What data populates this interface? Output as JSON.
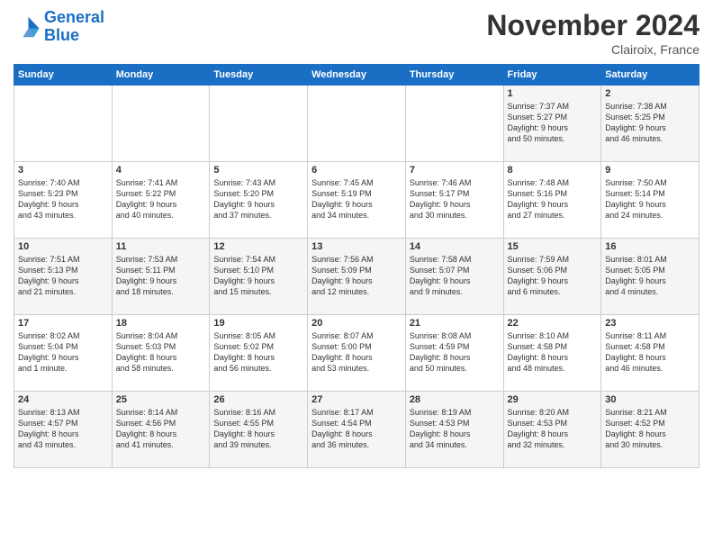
{
  "header": {
    "logo_line1": "General",
    "logo_line2": "Blue",
    "title": "November 2024",
    "location": "Clairoix, France"
  },
  "weekdays": [
    "Sunday",
    "Monday",
    "Tuesday",
    "Wednesday",
    "Thursday",
    "Friday",
    "Saturday"
  ],
  "weeks": [
    [
      {
        "day": "",
        "content": ""
      },
      {
        "day": "",
        "content": ""
      },
      {
        "day": "",
        "content": ""
      },
      {
        "day": "",
        "content": ""
      },
      {
        "day": "",
        "content": ""
      },
      {
        "day": "1",
        "content": "Sunrise: 7:37 AM\nSunset: 5:27 PM\nDaylight: 9 hours\nand 50 minutes."
      },
      {
        "day": "2",
        "content": "Sunrise: 7:38 AM\nSunset: 5:25 PM\nDaylight: 9 hours\nand 46 minutes."
      }
    ],
    [
      {
        "day": "3",
        "content": "Sunrise: 7:40 AM\nSunset: 5:23 PM\nDaylight: 9 hours\nand 43 minutes."
      },
      {
        "day": "4",
        "content": "Sunrise: 7:41 AM\nSunset: 5:22 PM\nDaylight: 9 hours\nand 40 minutes."
      },
      {
        "day": "5",
        "content": "Sunrise: 7:43 AM\nSunset: 5:20 PM\nDaylight: 9 hours\nand 37 minutes."
      },
      {
        "day": "6",
        "content": "Sunrise: 7:45 AM\nSunset: 5:19 PM\nDaylight: 9 hours\nand 34 minutes."
      },
      {
        "day": "7",
        "content": "Sunrise: 7:46 AM\nSunset: 5:17 PM\nDaylight: 9 hours\nand 30 minutes."
      },
      {
        "day": "8",
        "content": "Sunrise: 7:48 AM\nSunset: 5:16 PM\nDaylight: 9 hours\nand 27 minutes."
      },
      {
        "day": "9",
        "content": "Sunrise: 7:50 AM\nSunset: 5:14 PM\nDaylight: 9 hours\nand 24 minutes."
      }
    ],
    [
      {
        "day": "10",
        "content": "Sunrise: 7:51 AM\nSunset: 5:13 PM\nDaylight: 9 hours\nand 21 minutes."
      },
      {
        "day": "11",
        "content": "Sunrise: 7:53 AM\nSunset: 5:11 PM\nDaylight: 9 hours\nand 18 minutes."
      },
      {
        "day": "12",
        "content": "Sunrise: 7:54 AM\nSunset: 5:10 PM\nDaylight: 9 hours\nand 15 minutes."
      },
      {
        "day": "13",
        "content": "Sunrise: 7:56 AM\nSunset: 5:09 PM\nDaylight: 9 hours\nand 12 minutes."
      },
      {
        "day": "14",
        "content": "Sunrise: 7:58 AM\nSunset: 5:07 PM\nDaylight: 9 hours\nand 9 minutes."
      },
      {
        "day": "15",
        "content": "Sunrise: 7:59 AM\nSunset: 5:06 PM\nDaylight: 9 hours\nand 6 minutes."
      },
      {
        "day": "16",
        "content": "Sunrise: 8:01 AM\nSunset: 5:05 PM\nDaylight: 9 hours\nand 4 minutes."
      }
    ],
    [
      {
        "day": "17",
        "content": "Sunrise: 8:02 AM\nSunset: 5:04 PM\nDaylight: 9 hours\nand 1 minute."
      },
      {
        "day": "18",
        "content": "Sunrise: 8:04 AM\nSunset: 5:03 PM\nDaylight: 8 hours\nand 58 minutes."
      },
      {
        "day": "19",
        "content": "Sunrise: 8:05 AM\nSunset: 5:02 PM\nDaylight: 8 hours\nand 56 minutes."
      },
      {
        "day": "20",
        "content": "Sunrise: 8:07 AM\nSunset: 5:00 PM\nDaylight: 8 hours\nand 53 minutes."
      },
      {
        "day": "21",
        "content": "Sunrise: 8:08 AM\nSunset: 4:59 PM\nDaylight: 8 hours\nand 50 minutes."
      },
      {
        "day": "22",
        "content": "Sunrise: 8:10 AM\nSunset: 4:58 PM\nDaylight: 8 hours\nand 48 minutes."
      },
      {
        "day": "23",
        "content": "Sunrise: 8:11 AM\nSunset: 4:58 PM\nDaylight: 8 hours\nand 46 minutes."
      }
    ],
    [
      {
        "day": "24",
        "content": "Sunrise: 8:13 AM\nSunset: 4:57 PM\nDaylight: 8 hours\nand 43 minutes."
      },
      {
        "day": "25",
        "content": "Sunrise: 8:14 AM\nSunset: 4:56 PM\nDaylight: 8 hours\nand 41 minutes."
      },
      {
        "day": "26",
        "content": "Sunrise: 8:16 AM\nSunset: 4:55 PM\nDaylight: 8 hours\nand 39 minutes."
      },
      {
        "day": "27",
        "content": "Sunrise: 8:17 AM\nSunset: 4:54 PM\nDaylight: 8 hours\nand 36 minutes."
      },
      {
        "day": "28",
        "content": "Sunrise: 8:19 AM\nSunset: 4:53 PM\nDaylight: 8 hours\nand 34 minutes."
      },
      {
        "day": "29",
        "content": "Sunrise: 8:20 AM\nSunset: 4:53 PM\nDaylight: 8 hours\nand 32 minutes."
      },
      {
        "day": "30",
        "content": "Sunrise: 8:21 AM\nSunset: 4:52 PM\nDaylight: 8 hours\nand 30 minutes."
      }
    ]
  ]
}
